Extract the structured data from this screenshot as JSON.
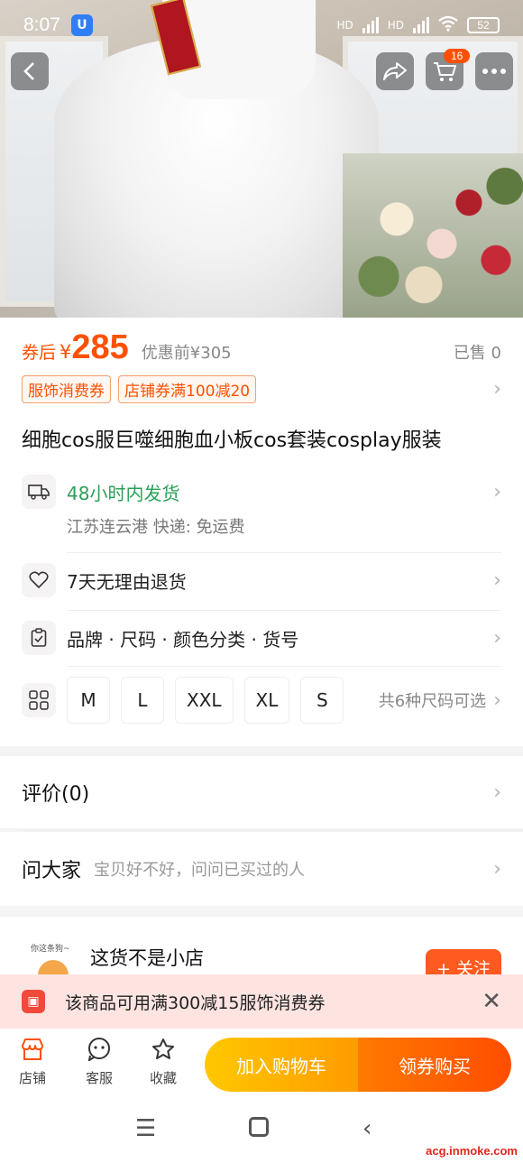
{
  "status_bar": {
    "time": "8:07",
    "app_badge": "U",
    "signal1_label": "HD",
    "signal2_label": "HD",
    "battery": "52"
  },
  "nav": {
    "back_icon": "chevron-left-icon",
    "share_icon": "share-icon",
    "cart_icon": "cart-icon",
    "cart_count": "16",
    "more_icon": "more-icon"
  },
  "price": {
    "label": "券后",
    "currency": "¥",
    "value": "285",
    "original": "优惠前¥305",
    "sold": "已售 0"
  },
  "coupons": [
    "服饰消费券",
    "店铺券满100减20"
  ],
  "product_title": "细胞cos服巨噬细胞血小板cos套装cosplay服装",
  "shipping": {
    "title": "48小时内发货",
    "subtitle": "江苏连云港  快递: 免运费"
  },
  "returns": {
    "title": "7天无理由退货"
  },
  "specs": {
    "title": "品牌 · 尺码 · 颜色分类 · 货号"
  },
  "sizes": {
    "options": [
      "M",
      "L",
      "XXL",
      "XL",
      "S"
    ],
    "summary": "共6种尺码可选"
  },
  "reviews": {
    "title": "评价(0)"
  },
  "ask": {
    "title": "问大家",
    "subtitle": "宝贝好不好，问问已买过的人"
  },
  "shop": {
    "logo_text": "你这条狗~",
    "name": "这货不是小店",
    "follow_label": "+ 关注"
  },
  "banner": {
    "text": "该商品可用满300减15服饰消费券",
    "close": "✕"
  },
  "actions": {
    "shop_label": "店铺",
    "service_label": "客服",
    "favorite_label": "收藏",
    "add_cart_label": "加入购物车",
    "buy_label": "领券购买"
  },
  "watermark": "acg.inmoke.com",
  "colors": {
    "accent": "#ff5000",
    "green": "#2aa058"
  }
}
